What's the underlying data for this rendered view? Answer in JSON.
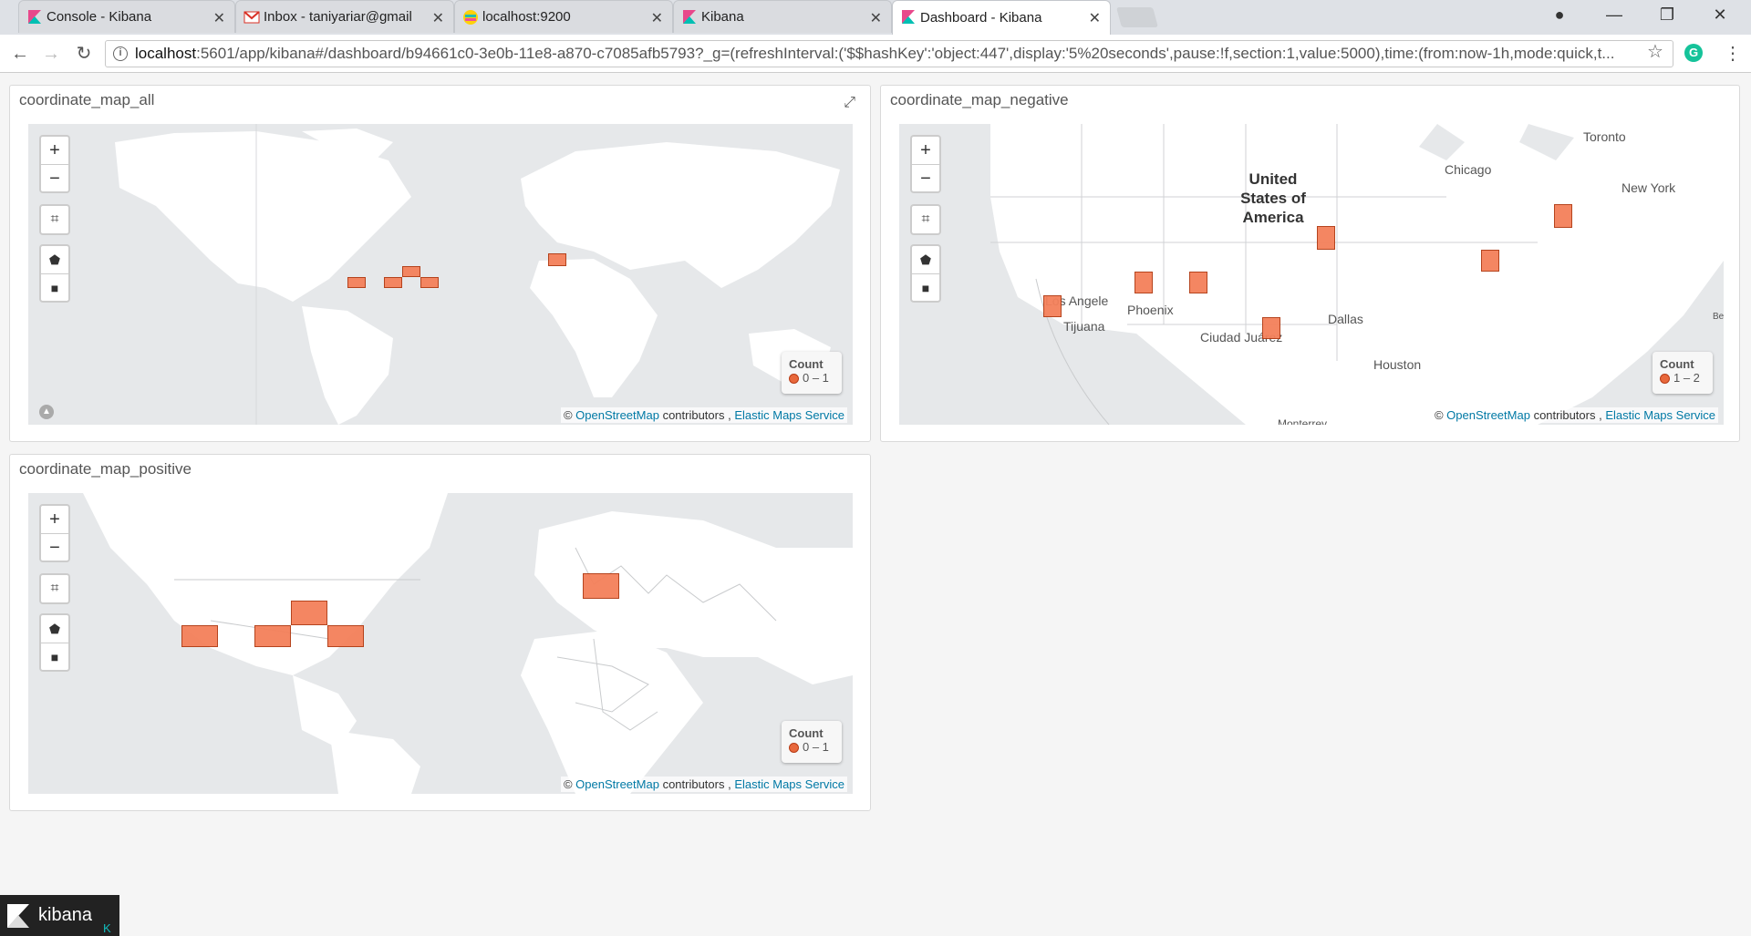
{
  "browser": {
    "tabs": [
      {
        "title": "Console - Kibana",
        "icon": "kibana-icon"
      },
      {
        "title": "Inbox - taniyariar@gmail",
        "icon": "gmail-icon"
      },
      {
        "title": "localhost:9200",
        "icon": "elastic-icon"
      },
      {
        "title": "Kibana",
        "icon": "kibana-icon"
      },
      {
        "title": "Dashboard - Kibana",
        "icon": "kibana-icon",
        "active": true
      }
    ],
    "url_host": "localhost",
    "url_rest": ":5601/app/kibana#/dashboard/b94661c0-3e0b-11e8-a870-c7085afb5793?_g=(refreshInterval:('$$hashKey':'object:447',display:'5%20seconds',pause:!f,section:1,value:5000),time:(from:now-1h,mode:quick,t..."
  },
  "panels": [
    {
      "title": "coordinate_map_all",
      "legend_title": "Count",
      "legend_range": "0 – 1",
      "attribution": {
        "osm": "OpenStreetMap",
        "contributors": "contributors ,",
        "ems": "Elastic Maps Service"
      }
    },
    {
      "title": "coordinate_map_negative",
      "legend_title": "Count",
      "legend_range": "1 – 2",
      "attribution": {
        "osm": "OpenStreetMap",
        "contributors": "contributors ,",
        "ems": "Elastic Maps Service"
      },
      "labels": {
        "country": "United States of America",
        "cities": [
          "Toronto",
          "Chicago",
          "New York",
          "Los Angele",
          "Phoenix",
          "Tijuana",
          "Dallas",
          "Ciudad Juárez",
          "Houston",
          "Be",
          "Monterrey"
        ]
      }
    },
    {
      "title": "coordinate_map_positive",
      "legend_title": "Count",
      "legend_range": "0 – 1",
      "attribution": {
        "osm": "OpenStreetMap",
        "contributors": "contributors ,",
        "ems": "Elastic Maps Service"
      }
    }
  ],
  "map_controls": {
    "zoom_in": "+",
    "zoom_out": "−"
  },
  "colors": {
    "cell_fill": "#f4805a",
    "cell_border": "#b23a12",
    "link": "#0079a5"
  },
  "footer": {
    "brand": "kibana",
    "collapse": "K"
  }
}
